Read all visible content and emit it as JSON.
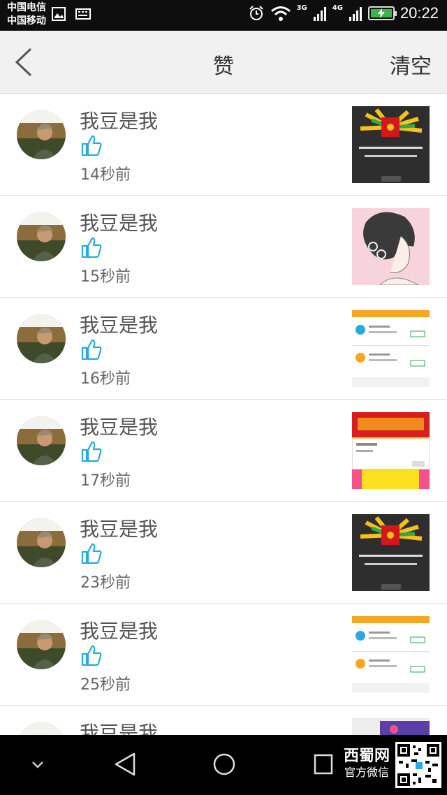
{
  "status": {
    "carrier_1": "中国电信",
    "carrier_2": "中国移动",
    "net_3g": "3G",
    "net_4g": "4G",
    "time": "20:22"
  },
  "header": {
    "title": "赞",
    "clear_label": "清空",
    "back_icon": "chevron-left-icon"
  },
  "likes": [
    {
      "name": "我豆是我",
      "time": "14秒前",
      "thumb": "red-envelope"
    },
    {
      "name": "我豆是我",
      "time": "15秒前",
      "thumb": "girl-sketch"
    },
    {
      "name": "我豆是我",
      "time": "16秒前",
      "thumb": "app-list"
    },
    {
      "name": "我豆是我",
      "time": "17秒前",
      "thumb": "scratch-card"
    },
    {
      "name": "我豆是我",
      "time": "23秒前",
      "thumb": "red-envelope"
    },
    {
      "name": "我豆是我",
      "time": "25秒前",
      "thumb": "app-list"
    },
    {
      "name": "我豆是我",
      "time": "",
      "thumb": "purple-app"
    }
  ],
  "watermark": {
    "line1": "西蜀网",
    "line2": "官方微信"
  },
  "colors": {
    "like_blue": "#29a9e0",
    "status_bg": "#0e0e0e",
    "nav_bg": "#f1f1f1"
  }
}
